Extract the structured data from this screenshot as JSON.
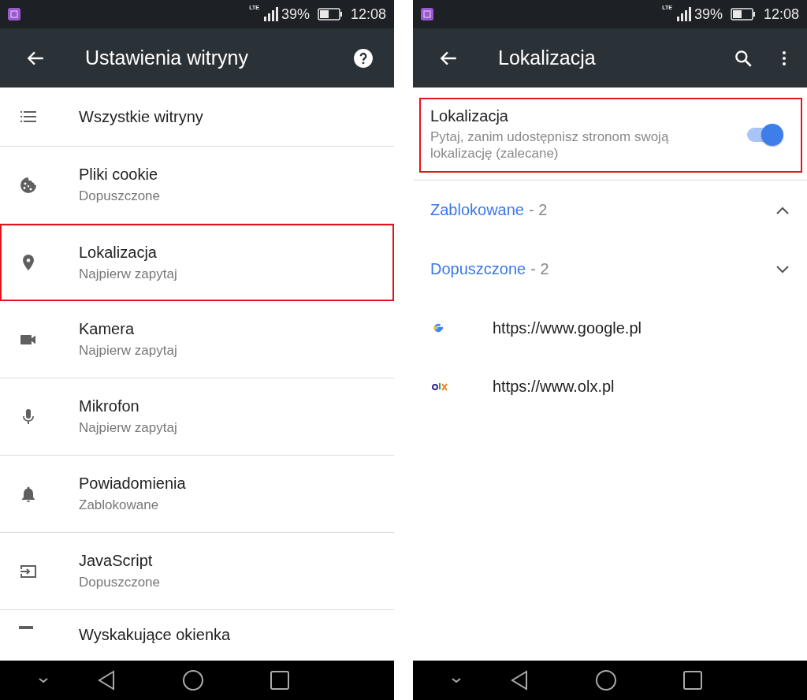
{
  "screens": [
    {
      "status_bar": {
        "network": "LTE",
        "battery": "39%",
        "time": "12:08"
      },
      "toolbar": {
        "title": "Ustawienia witryny",
        "actions": [
          {
            "kind": "help"
          }
        ]
      },
      "items": [
        {
          "title": "Wszystkie witryny",
          "highlighted": false
        },
        {
          "title": "Pliki cookie",
          "subtitle": "Dopuszczone",
          "highlighted": false
        },
        {
          "title": "Lokalizacja",
          "subtitle": "Najpierw zapytaj",
          "highlighted": true
        },
        {
          "title": "Kamera",
          "subtitle": "Najpierw zapytaj",
          "highlighted": false
        },
        {
          "title": "Mikrofon",
          "subtitle": "Najpierw zapytaj",
          "highlighted": false
        },
        {
          "title": "Powiadomienia",
          "subtitle": "Zablokowane",
          "highlighted": false
        },
        {
          "title": "JavaScript",
          "subtitle": "Dopuszczone",
          "highlighted": false
        },
        {
          "title": "Wyskakujące okienka",
          "highlighted": false
        }
      ]
    },
    {
      "status_bar": {
        "network": "LTE",
        "battery": "39%",
        "time": "12:08"
      },
      "toolbar": {
        "title": "Lokalizacja",
        "actions": [
          {
            "kind": "search"
          },
          {
            "kind": "more"
          }
        ]
      },
      "setting": {
        "title": "Lokalizacja",
        "description": "Pytaj, zanim udostępnisz stronom swoją lokalizację (zalecane)",
        "on": true,
        "highlighted": true
      },
      "groups": [
        {
          "label": "Zablokowane",
          "count": "- 2",
          "expanded": true
        },
        {
          "label": "Dopuszczone",
          "count": "- 2",
          "expanded": false
        }
      ],
      "sites": [
        "https://www.google.pl",
        "https://www.olx.pl"
      ]
    }
  ]
}
